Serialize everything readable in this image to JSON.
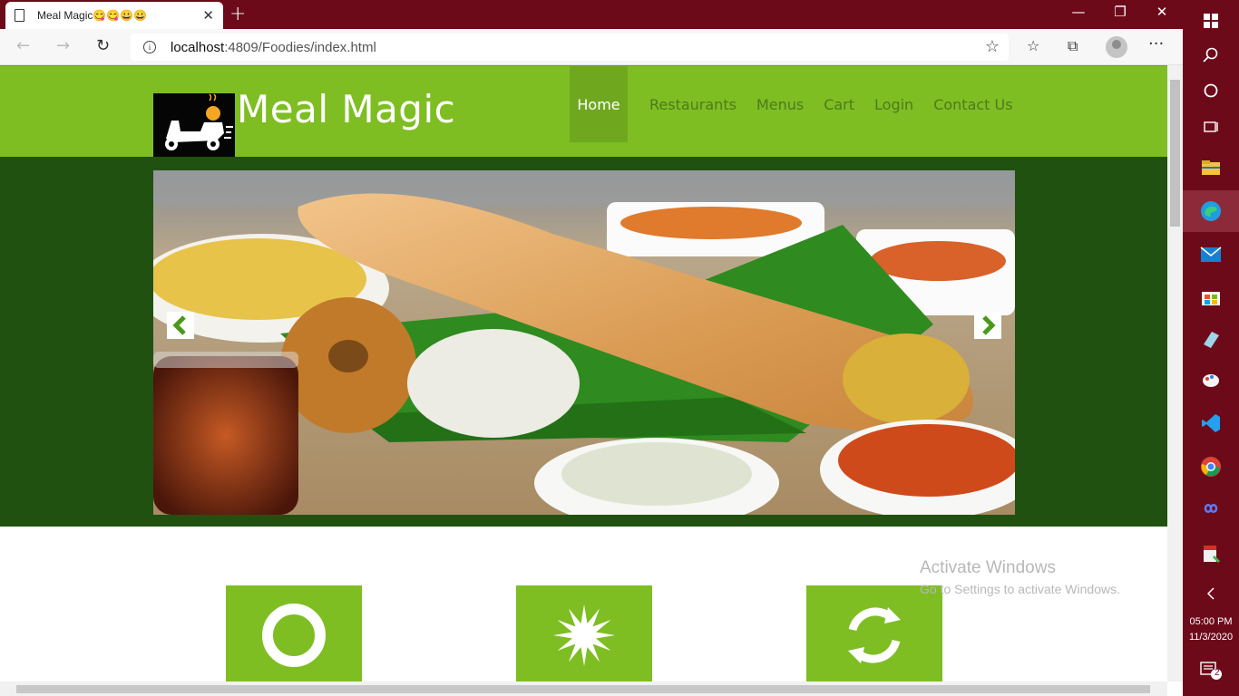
{
  "browser": {
    "tab_title": "Meal Magic😋😋😀😀",
    "url_host": "localhost",
    "url_rest": ":4809/Foodies/index.html"
  },
  "site": {
    "brand": "Meal Magic",
    "nav": [
      "Home",
      "Restaurants",
      "Menus",
      "Cart",
      "Login",
      "Contact Us"
    ],
    "active_nav": "Home",
    "features": [
      {
        "icon": "ring-icon"
      },
      {
        "icon": "starburst-icon"
      },
      {
        "icon": "refresh-icon"
      }
    ]
  },
  "watermark": {
    "line1": "Activate Windows",
    "line2": "Go to Settings to activate Windows."
  },
  "taskbar": {
    "time": "05:00 PM",
    "date": "11/3/2020",
    "notifications": "2"
  },
  "colors": {
    "header_green": "#7ebe23",
    "banner_green": "#215110",
    "taskbar": "#6d0a1a"
  }
}
